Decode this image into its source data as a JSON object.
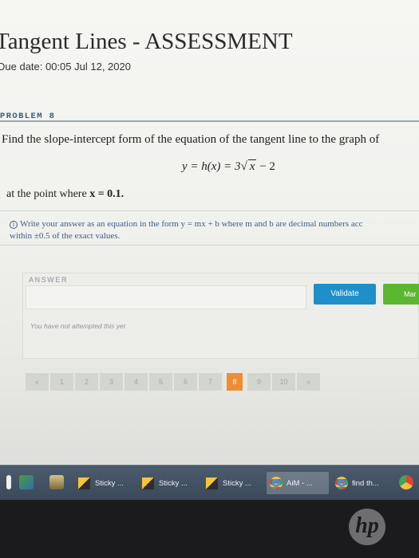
{
  "page": {
    "title": "Tangent Lines - ASSESSMENT",
    "due_date": "Due date: 00:05 Jul 12, 2020"
  },
  "problem": {
    "label": "PROBLEM 8",
    "statement": "Find the slope-intercept form of the equation of the tangent line to the graph of",
    "equation": {
      "lhs": "y = h(x) = 3",
      "radicand": "x",
      "rhs": "− 2"
    },
    "point_prefix": "at the point where ",
    "point_value": "x = 0.1.",
    "hint_line1": "Write your answer as an equation in the form y = mx + b where m and b are decimal numbers acc",
    "hint_line2": "within ±0.5 of the exact values."
  },
  "answer": {
    "label": "ANSWER",
    "input_value": "",
    "validate_label": "Validate",
    "mark_label": "Mar",
    "status": "You have not attempted this yet"
  },
  "pager": {
    "prev": "«",
    "pages": [
      "1",
      "2",
      "3",
      "4",
      "5",
      "6",
      "7",
      "8",
      "9",
      "10"
    ],
    "next": "»",
    "active": "8"
  },
  "taskbar": {
    "items": [
      "Sticky ...",
      "Sticky ...",
      "Sticky ...",
      "AiM - ...",
      "find th..."
    ]
  },
  "brand": {
    "logo": "hp"
  },
  "colors": {
    "validate": "#1f8fc9",
    "mark": "#5bb630",
    "active_page": "#ee8d33",
    "hint_text": "#3f5d86"
  }
}
